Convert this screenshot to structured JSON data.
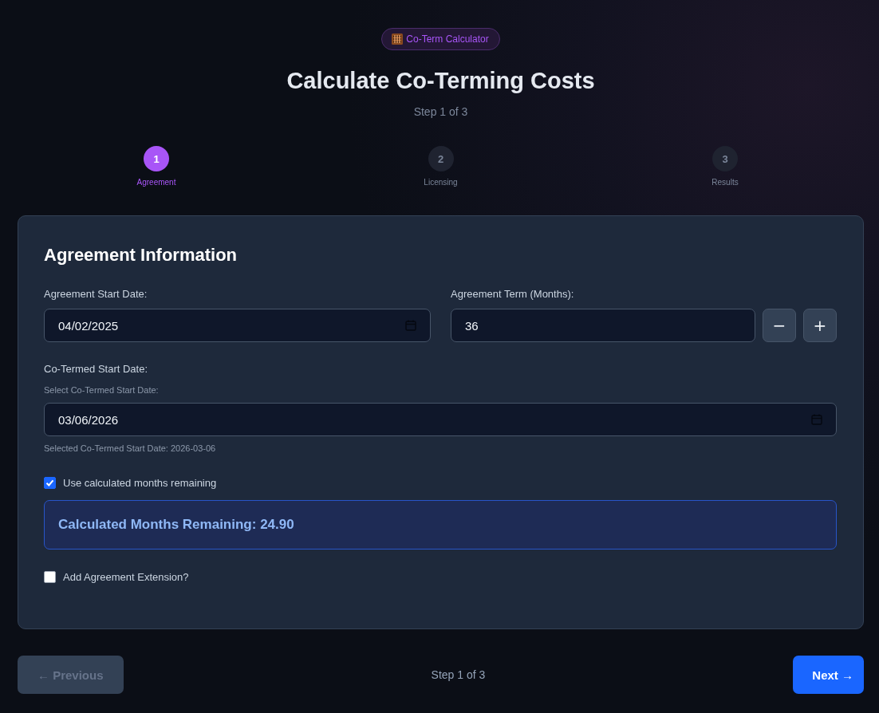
{
  "badge": {
    "label": "Co-Term Calculator"
  },
  "title": "Calculate Co-Terming Costs",
  "subtitle": "Step 1 of 3",
  "steps": [
    {
      "number": "1",
      "label": "Agreement",
      "selected": true
    },
    {
      "number": "2",
      "label": "Licensing",
      "selected": false
    },
    {
      "number": "3",
      "label": "Results",
      "selected": false
    }
  ],
  "card": {
    "title": "Agreement Information",
    "start_date": {
      "label": "Agreement Start Date:",
      "value": "04/02/2025"
    },
    "term": {
      "label": "Agreement Term (Months):",
      "value": "36",
      "decrement": "−",
      "increment": "+"
    },
    "co_termed": {
      "label": "Co-Termed Start Date:",
      "hint": "Select Co-Termed Start Date:",
      "value": "03/06/2026",
      "selected_text": "Selected Co-Termed Start Date: 2026-03-06"
    },
    "use_calculated": {
      "label": "Use calculated months remaining",
      "checked": true
    },
    "calculated": {
      "text": "Calculated Months Remaining: 24.90"
    },
    "extension": {
      "label": "Add Agreement Extension?",
      "checked": false
    }
  },
  "footer": {
    "previous": {
      "label": "← Previous",
      "disabled": true
    },
    "step": "Step 1 of 3",
    "next": {
      "label": "Next →",
      "disabled": false
    }
  }
}
